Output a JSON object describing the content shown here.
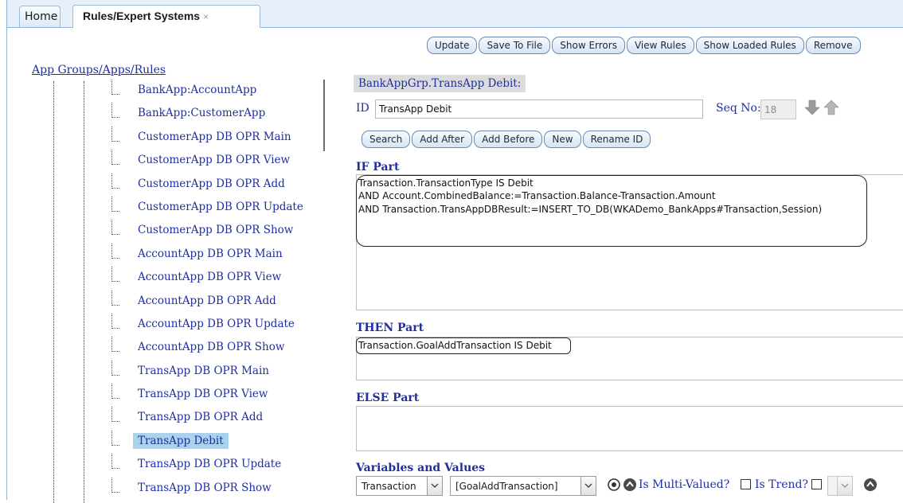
{
  "tabs": [
    {
      "label": "Home"
    },
    {
      "label": "Rules/Expert Systems",
      "close": "×"
    }
  ],
  "toolbar": {
    "update": "Update",
    "save_to_file": "Save To File",
    "show_errors": "Show Errors",
    "view_rules": "View Rules",
    "show_loaded_rules": "Show Loaded Rules",
    "remove": "Remove"
  },
  "tree": {
    "title": "App Groups/Apps/Rules",
    "items": [
      "BankApp:AccountApp",
      "BankApp:CustomerApp",
      "CustomerApp DB OPR Main",
      "CustomerApp DB OPR View",
      "CustomerApp DB OPR Add",
      "CustomerApp DB OPR Update",
      "CustomerApp DB OPR Show",
      "AccountApp DB OPR Main",
      "AccountApp DB OPR View",
      "AccountApp DB OPR Add",
      "AccountApp DB OPR Update",
      "AccountApp DB OPR Show",
      "TransApp DB OPR Main",
      "TransApp DB OPR View",
      "TransApp DB OPR Add",
      "TransApp Debit",
      "TransApp DB OPR Update",
      "TransApp DB OPR Show"
    ],
    "selected": "TransApp Debit"
  },
  "editor": {
    "breadcrumb": "BankAppGrp.TransApp Debit:",
    "id_label": "ID",
    "id_value": "TransApp Debit",
    "seq_label": "Seq No:",
    "seq_value": "18",
    "actions": {
      "search": "Search",
      "add_after": "Add After",
      "add_before": "Add Before",
      "new": "New",
      "rename_id": "Rename ID"
    },
    "if_label": "IF Part",
    "if_lines": [
      "Transaction.TransactionType IS Debit",
      "AND Account.CombinedBalance:=Transaction.Balance-Transaction.Amount",
      "AND Transaction.TransAppDBResult:=INSERT_TO_DB(WKADemo_BankApps#Transaction,Session)"
    ],
    "then_label": "THEN Part",
    "then_lines": [
      "Transaction.GoalAddTransaction IS Debit"
    ],
    "else_label": "ELSE Part",
    "vars_label": "Variables and Values",
    "var_object": "Transaction",
    "var_attribute": "[GoalAddTransaction]",
    "multi_valued_label": "Is Multi-Valued?",
    "trend_label": "Is Trend?"
  },
  "icons": {
    "down_arrow": "down-arrow-icon",
    "up_arrow": "up-arrow-icon",
    "refresh": "refresh-icon",
    "expand": "expand-icon",
    "collapse": "collapse-icon"
  },
  "colors": {
    "link_blue": "#1f2f9f",
    "selected_bg": "#a9d3ec",
    "tab_bar": "#e7f0fa",
    "button_border": "#6d8bb0"
  }
}
